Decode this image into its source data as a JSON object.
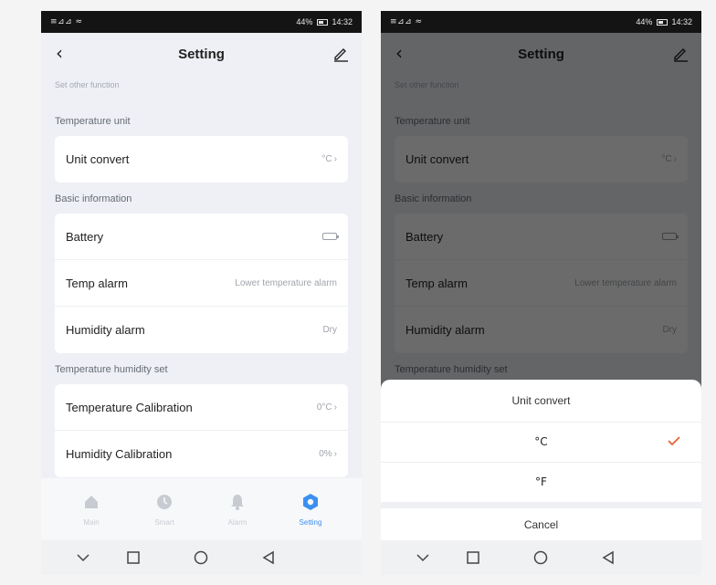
{
  "status_bar": {
    "signal_text": "≡⊿⊿ ≈",
    "battery": "44%",
    "time": "14:32"
  },
  "header": {
    "title": "Setting"
  },
  "subtitle": "Set other function",
  "sections": {
    "temperature_unit": {
      "label": "Temperature unit",
      "rows": [
        {
          "label": "Unit convert",
          "value": "°C"
        }
      ]
    },
    "basic_information": {
      "label": "Basic information",
      "rows": [
        {
          "label": "Battery",
          "value": ""
        },
        {
          "label": "Temp alarm",
          "value": "Lower temperature alarm"
        },
        {
          "label": "Humidity alarm",
          "value": "Dry"
        }
      ]
    },
    "temperature_humidity_set": {
      "label": "Temperature humidity set",
      "rows": [
        {
          "label": "Temperature Calibration",
          "value": "0°C"
        },
        {
          "label": "Humidity Calibration",
          "value": "0%"
        }
      ]
    }
  },
  "tabbar": {
    "items": [
      {
        "label": "Main",
        "icon": "home-icon"
      },
      {
        "label": "Smart",
        "icon": "clock-icon"
      },
      {
        "label": "Alarm",
        "icon": "bell-icon"
      },
      {
        "label": "Setting",
        "icon": "gear-icon"
      }
    ],
    "active_color": "#3b8ff0"
  },
  "sheet": {
    "title": "Unit convert",
    "options": [
      {
        "label": "°C",
        "selected": true
      },
      {
        "label": "°F",
        "selected": false
      }
    ],
    "cancel_label": "Cancel",
    "check_color": "#e8623a"
  }
}
